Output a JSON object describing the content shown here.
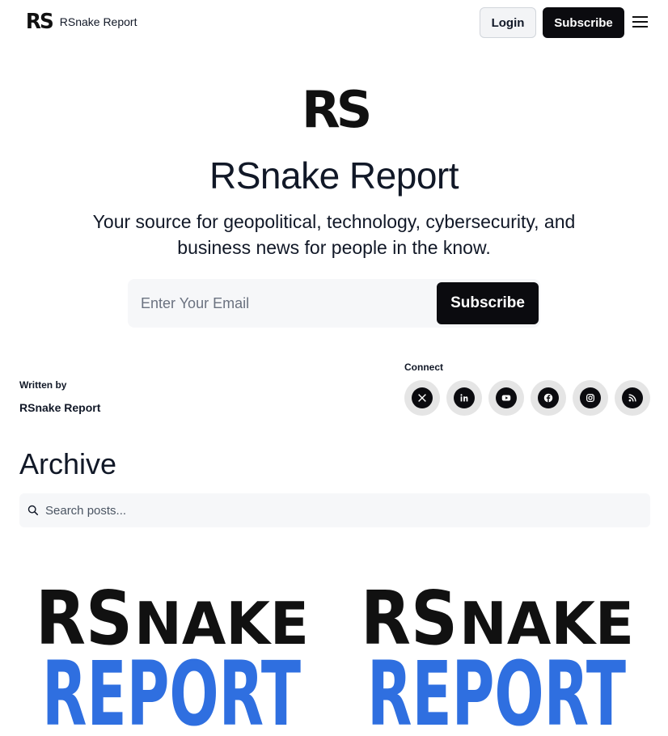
{
  "nav": {
    "logo_text": "RS",
    "brand_name": "RSnake Report",
    "login_label": "Login",
    "subscribe_label": "Subscribe",
    "menu_icon": "hamburger-menu-icon"
  },
  "hero": {
    "logo_text": "RS",
    "title": "RSnake Report",
    "subtitle": "Your source for geopolitical, technology, cybersecurity, and business news for people in the know.",
    "email_placeholder": "Enter Your Email",
    "email_value": "",
    "subscribe_label": "Subscribe"
  },
  "author": {
    "label": "Written by",
    "name": "RSnake Report"
  },
  "connect": {
    "label": "Connect",
    "socials": [
      "x-icon",
      "linkedin-icon",
      "youtube-icon",
      "facebook-icon",
      "instagram-icon",
      "rss-icon"
    ]
  },
  "archive": {
    "title": "Archive",
    "search_placeholder": "Search posts...",
    "search_value": ""
  },
  "posts": [
    {
      "thumb_line1": "RSNAKE",
      "thumb_line2": "REPORT"
    },
    {
      "thumb_line1": "RSNAKE",
      "thumb_line2": "REPORT"
    }
  ],
  "colors": {
    "primary_button": "#0b0b0f",
    "report_blue": "#2f6fe0",
    "input_bg": "#f6f7f9"
  }
}
